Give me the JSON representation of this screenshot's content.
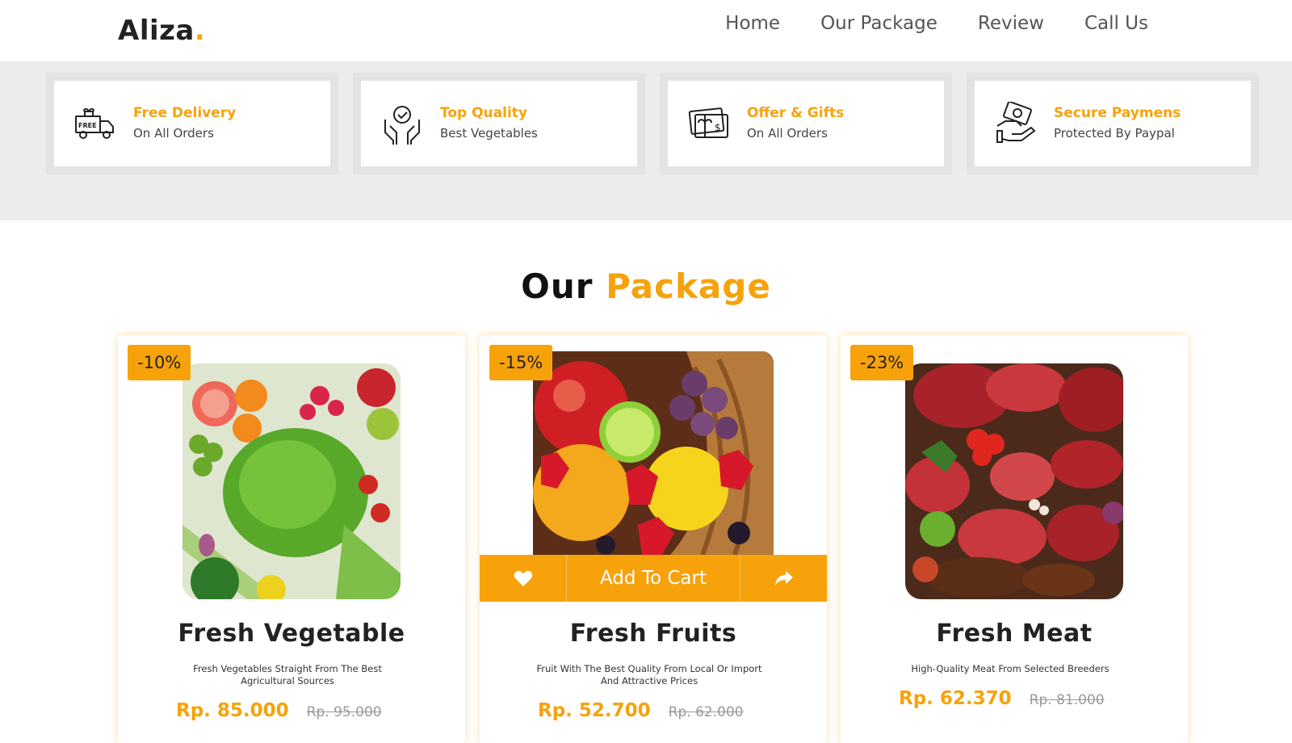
{
  "brand": {
    "name": "Aliza",
    "dot": "."
  },
  "nav": [
    {
      "label": "Home"
    },
    {
      "label": "Our Package"
    },
    {
      "label": "Review"
    },
    {
      "label": "Call Us"
    }
  ],
  "features": [
    {
      "title": "Free Delivery",
      "subtitle": "On All Orders",
      "icon": "delivery-truck-icon"
    },
    {
      "title": "Top Quality",
      "subtitle": "Best Vegetables",
      "icon": "quality-badge-icon"
    },
    {
      "title": "Offer & Gifts",
      "subtitle": "On All Orders",
      "icon": "gift-card-icon"
    },
    {
      "title": "Secure Paymens",
      "subtitle": "Protected By Paypal",
      "icon": "secure-payment-icon"
    }
  ],
  "section": {
    "title_plain": "Our",
    "title_accent": "Package"
  },
  "products": [
    {
      "badge": "-10%",
      "name": "Fresh Vegetable",
      "description": "Fresh Vegetables Straight From The Best Agricultural Sources",
      "price": "Rp. 85.000",
      "old_price": "Rp. 95.000"
    },
    {
      "badge": "-15%",
      "name": "Fresh Fruits",
      "description": "Fruit With The Best Quality From Local Or Import And Attractive Prices",
      "price": "Rp. 52.700",
      "old_price": "Rp. 62.000",
      "cart_label": "Add To Cart"
    },
    {
      "badge": "-23%",
      "name": "Fresh Meat",
      "description": "High-Quality Meat From Selected Breeders",
      "price": "Rp. 62.370",
      "old_price": "Rp. 81.000"
    }
  ],
  "colors": {
    "accent": "#f7a20b",
    "band": "#ececec"
  }
}
